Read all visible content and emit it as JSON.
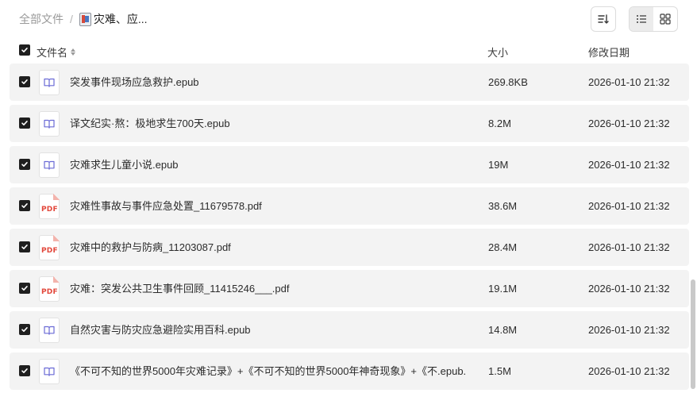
{
  "breadcrumb": {
    "root": "全部文件",
    "separator": "/",
    "current": "灾难、应..."
  },
  "header": {
    "name": "文件名",
    "size": "大小",
    "modified": "修改日期"
  },
  "colors": {
    "checkbox": "#1f1f1f",
    "row_bg": "#f3f3f3",
    "epub_icon": "#6b6bd6",
    "pdf_icon": "#e2473b"
  },
  "files": [
    {
      "name": "突发事件现场应急救护.epub",
      "type": "epub",
      "size": "269.8KB",
      "date": "2026-01-10 21:32",
      "checked": true
    },
    {
      "name": "译文纪实·熬：极地求生700天.epub",
      "type": "epub",
      "size": "8.2M",
      "date": "2026-01-10 21:32",
      "checked": true
    },
    {
      "name": "灾难求生儿童小说.epub",
      "type": "epub",
      "size": "19M",
      "date": "2026-01-10 21:32",
      "checked": true
    },
    {
      "name": "灾难性事故与事件应急处置_11679578.pdf",
      "type": "pdf",
      "size": "38.6M",
      "date": "2026-01-10 21:32",
      "checked": true
    },
    {
      "name": "灾难中的救护与防病_11203087.pdf",
      "type": "pdf",
      "size": "28.4M",
      "date": "2026-01-10 21:32",
      "checked": true
    },
    {
      "name": "灾难：突发公共卫生事件回顾_11415246___.pdf",
      "type": "pdf",
      "size": "19.1M",
      "date": "2026-01-10 21:32",
      "checked": true
    },
    {
      "name": "自然灾害与防灾应急避险实用百科.epub",
      "type": "epub",
      "size": "14.8M",
      "date": "2026-01-10 21:32",
      "checked": true
    },
    {
      "name": "《不可不知的世界5000年灾难记录》+《不可不知的世界5000年神奇现象》+《不.epub....",
      "type": "epub",
      "size": "1.5M",
      "date": "2026-01-10 21:32",
      "checked": true
    }
  ],
  "pdf_label": "PDF"
}
